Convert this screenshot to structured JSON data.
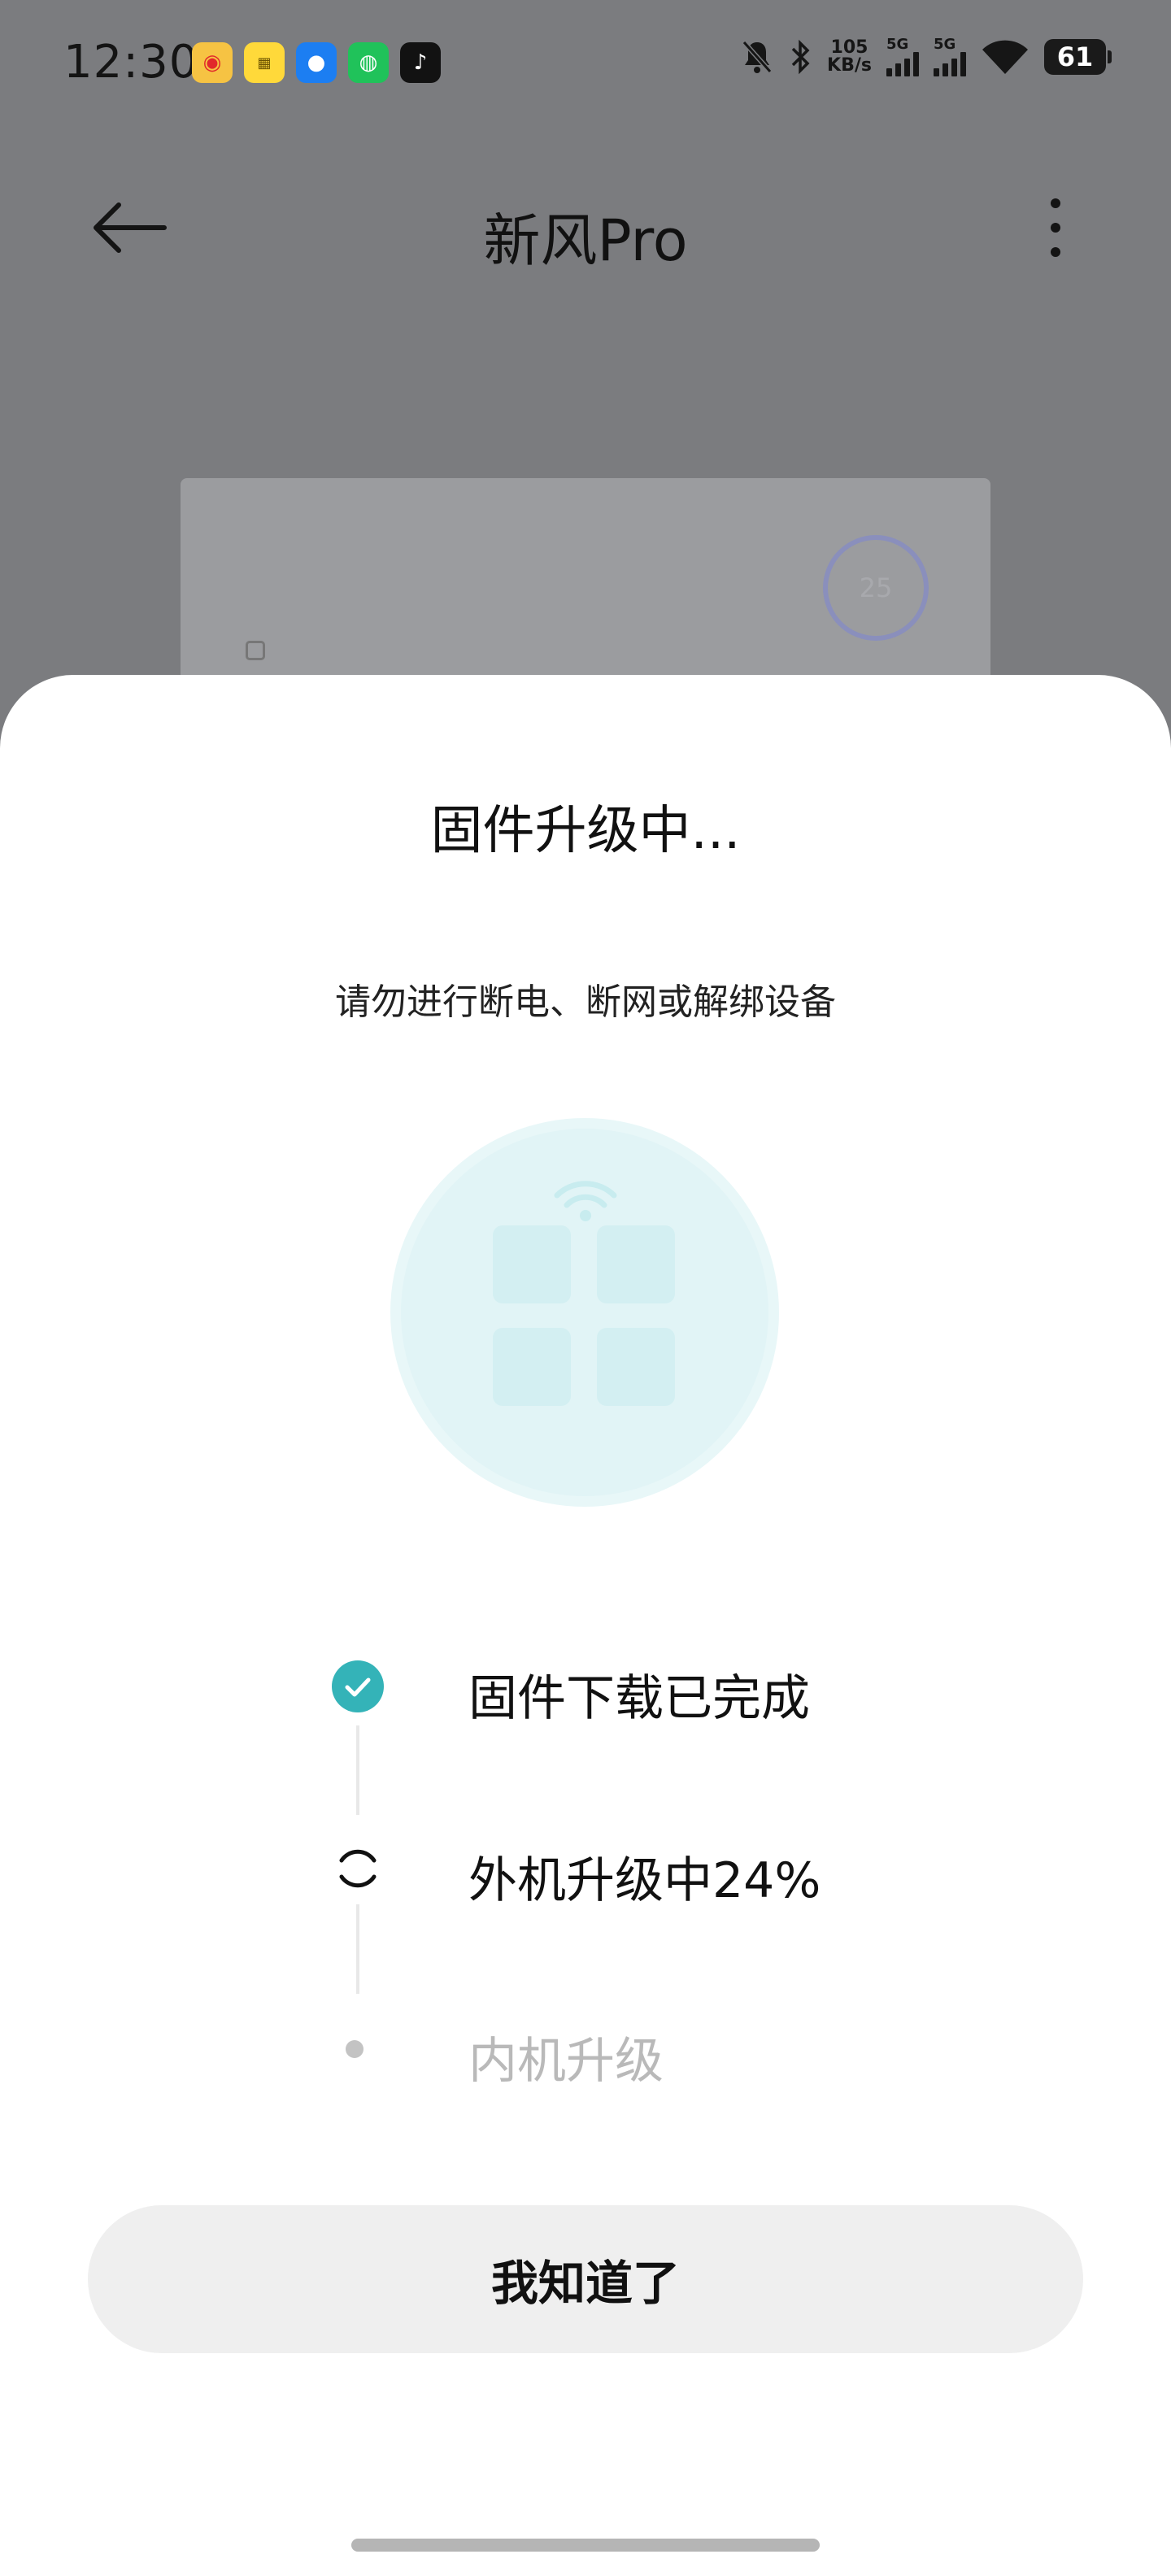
{
  "status_bar": {
    "time": "12:30",
    "net_speed_value": "105",
    "net_speed_unit": "KB/s",
    "signal_1": "5G",
    "signal_2": "5G",
    "battery": "61",
    "icons": [
      "weibo-app-icon",
      "yellow-app-icon",
      "blue-app-icon",
      "wechat-app-icon",
      "tiktok-app-icon",
      "mute-bell-icon",
      "bluetooth-icon",
      "wifi-icon"
    ]
  },
  "header": {
    "title": "新风Pro"
  },
  "device": {
    "display_value": "25"
  },
  "sheet": {
    "title": "固件升级中...",
    "subtitle": "请勿进行断电、断网或解绑设备",
    "steps": [
      {
        "label": "固件下载已完成",
        "state": "done"
      },
      {
        "label": "外机升级中24%",
        "state": "in-progress",
        "progress": 24
      },
      {
        "label": "内机升级",
        "state": "pending"
      }
    ],
    "confirm_label": "我知道了"
  },
  "colors": {
    "accent": "#34b3b8",
    "text_primary": "#111111",
    "text_disabled": "#b9b9b9",
    "overlay": "#7b7c7f",
    "button_bg": "#efefef"
  }
}
